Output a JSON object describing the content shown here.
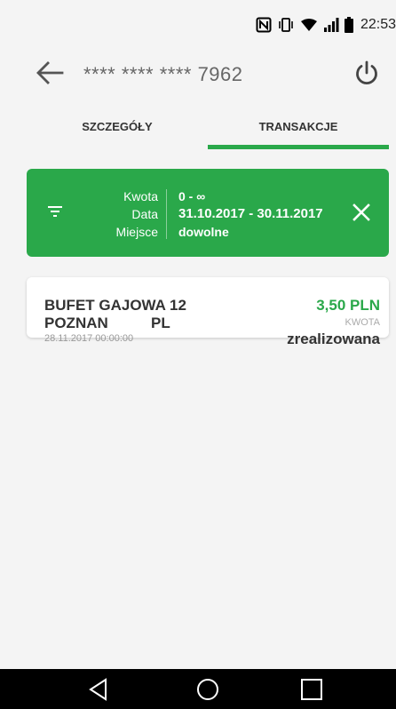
{
  "status_bar": {
    "time": "22:53",
    "icons": [
      "nfc-icon",
      "vibrate-icon",
      "wifi-icon",
      "signal-icon",
      "battery-icon"
    ]
  },
  "header": {
    "back_icon": "arrow-left-icon",
    "card_number": "**** **** **** 7962",
    "power_icon": "power-icon"
  },
  "tabs": [
    {
      "label": "SZCZEGÓŁY",
      "active": false
    },
    {
      "label": "TRANSAKCJE",
      "active": true
    }
  ],
  "filter": {
    "labels": [
      "Kwota",
      "Data",
      "Miejsce"
    ],
    "values": [
      "0 - ∞",
      "31.10.2017 - 30.11.2017",
      "dowolne"
    ],
    "icon": "filter-icon",
    "close_icon": "close-icon"
  },
  "transactions": [
    {
      "merchant": "BUFET GAJOWA 12",
      "city": "POZNAN",
      "country": "PL",
      "date": "28.11.2017 00:00:00",
      "amount": "3,50 PLN",
      "amount_label": "KWOTA",
      "status": "zrealizowana"
    }
  ],
  "nav": [
    "back-icon",
    "home-icon",
    "recents-icon"
  ],
  "colors": {
    "accent": "#2aa84a",
    "background": "#f4f4f4",
    "card": "#ffffff",
    "nav_bar": "#000000"
  }
}
